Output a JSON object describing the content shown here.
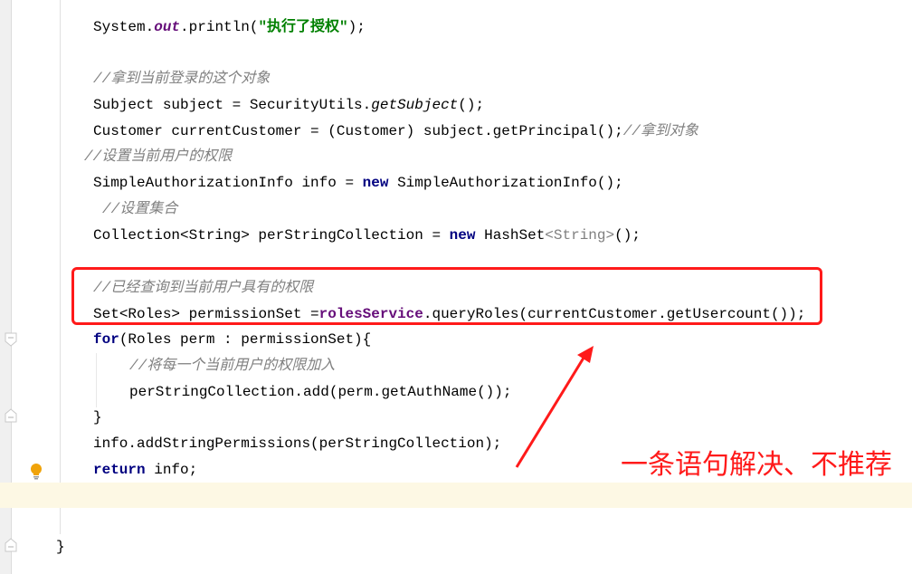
{
  "editor": {
    "lines": {
      "l1": {
        "a": "System.",
        "b": "out",
        "c": ".println(",
        "d": "\"执行了授权\"",
        "e": ");"
      },
      "l2": {
        "cmt": "//拿到当前登录的这个对象"
      },
      "l3": {
        "a": "Subject subject = SecurityUtils.",
        "b": "getSubject",
        "c": "();"
      },
      "l4": {
        "a": "Customer currentCustomer = (Customer) subject.getPrincipal();",
        "cmt": "//拿到对象"
      },
      "l5": {
        "cmt": "//设置当前用户的权限"
      },
      "l6": {
        "a": "SimpleAuthorizationInfo info = ",
        "kw": "new",
        "b": " SimpleAuthorizationInfo();"
      },
      "l7": {
        "cmt": "//设置集合"
      },
      "l8": {
        "a": "Collection",
        "g1": "<String>",
        "b": " perStringCollection = ",
        "kw": "new",
        "c": " HashSet",
        "g2": "<String>",
        "d": "();"
      },
      "l9": {
        "cmt": "//已经查询到当前用户具有的权限"
      },
      "l10": {
        "a": "Set",
        "g1": "<Roles>",
        "b": " permissionSet =",
        "f": "rolesService",
        "c": ".queryRoles(currentCustomer.getUsercount());"
      },
      "l11": {
        "kw": "for",
        "a": "(Roles perm : permissionSet){"
      },
      "l12": {
        "cmt": "//将每一个当前用户的权限加入"
      },
      "l13": {
        "a": "perStringCollection.add(perm.getAuthName());"
      },
      "l14": {
        "a": "}"
      },
      "l15": {
        "a": "info.addStringPermissions(perStringCollection);"
      },
      "l16": {
        "kw": "return",
        "a": " info;"
      },
      "l17": {
        "a": "}"
      }
    }
  },
  "annotation": {
    "text": "一条语句解决、不推荐",
    "color": "#ff1a1a"
  },
  "icons": {
    "intention": "lightbulb-icon",
    "fold": "fold-icon"
  }
}
